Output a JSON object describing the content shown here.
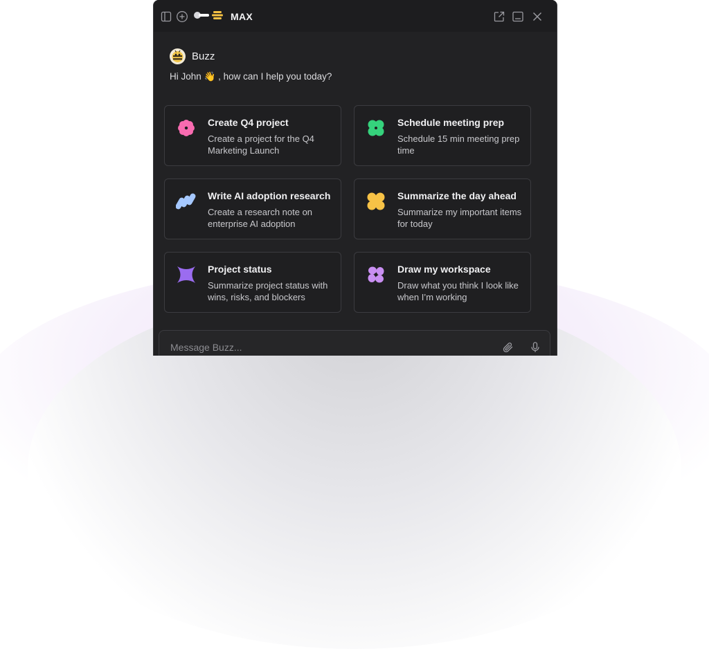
{
  "titlebar": {
    "brand_name": "MAX",
    "icons": [
      "sidebar-toggle-icon",
      "new-chat-icon",
      "brand-logo-icon",
      "open-external-icon",
      "minimize-icon",
      "close-icon"
    ]
  },
  "assistant": {
    "name": "Buzz"
  },
  "greeting": {
    "text": "Hi John 👋 , how can I help you today?"
  },
  "suggestions": [
    {
      "title": "Create Q4 project",
      "desc": "Create a project for the Q4 Marketing Launch",
      "icon": "flower-icon",
      "color": "#f86bb0"
    },
    {
      "title": "Schedule meeting prep",
      "desc": "Schedule 15 min meeting prep time",
      "icon": "clover-icon",
      "color": "#35d27c"
    },
    {
      "title": "Write AI adoption research",
      "desc": "Create a research note on enterprise AI adoption",
      "icon": "waves-icon",
      "color": "#a5c8ff"
    },
    {
      "title": "Summarize the day ahead",
      "desc": "Summarize my important items for today",
      "icon": "blob-icon",
      "color": "#f7c246"
    },
    {
      "title": "Project status",
      "desc": "Summarize project status with wins, risks, and blockers",
      "icon": "star-icon",
      "color": "#9b6cf0"
    },
    {
      "title": "Draw my workspace",
      "desc": "Draw what you think I look like when I’m working",
      "icon": "petals-icon",
      "color": "#c98ff2"
    }
  ],
  "composer": {
    "placeholder": "Message Buzz...",
    "icons": [
      "attach-icon",
      "microphone-icon"
    ]
  }
}
